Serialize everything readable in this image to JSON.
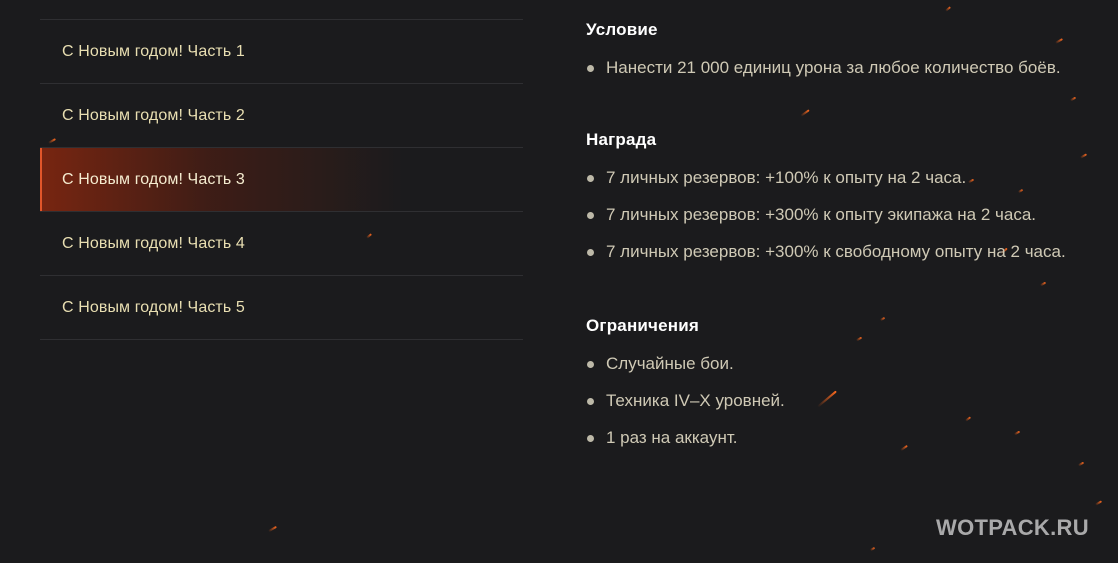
{
  "menu": {
    "items": [
      {
        "label": "С Новым годом! Часть 1"
      },
      {
        "label": "С Новым годом! Часть 2"
      },
      {
        "label": "С Новым годом! Часть 3"
      },
      {
        "label": "С Новым годом! Часть 4"
      },
      {
        "label": "С Новым годом! Часть 5"
      }
    ],
    "active_index": 2
  },
  "sections": [
    {
      "title": "Условие",
      "items": [
        "Нанести 21 000 единиц урона за любое количество боёв."
      ]
    },
    {
      "title": "Награда",
      "items": [
        "7 личных резервов: +100% к опыту на 2 часа.",
        "7 личных резервов: +300% к опыту экипажа на 2 часа.",
        "7 личных резервов: +300% к свободному опыту на 2 часа."
      ]
    },
    {
      "title": "Ограничения",
      "items": [
        "Случайные бои.",
        "Техника IV–X уровней.",
        "1 раз на аккаунт."
      ]
    }
  ],
  "watermark": "WOTPACK.RU",
  "colors": {
    "background": "#1b1b1d",
    "menu_text": "#e9dfb2",
    "accent": "#e1562a",
    "body_text": "#cfc9b5"
  }
}
